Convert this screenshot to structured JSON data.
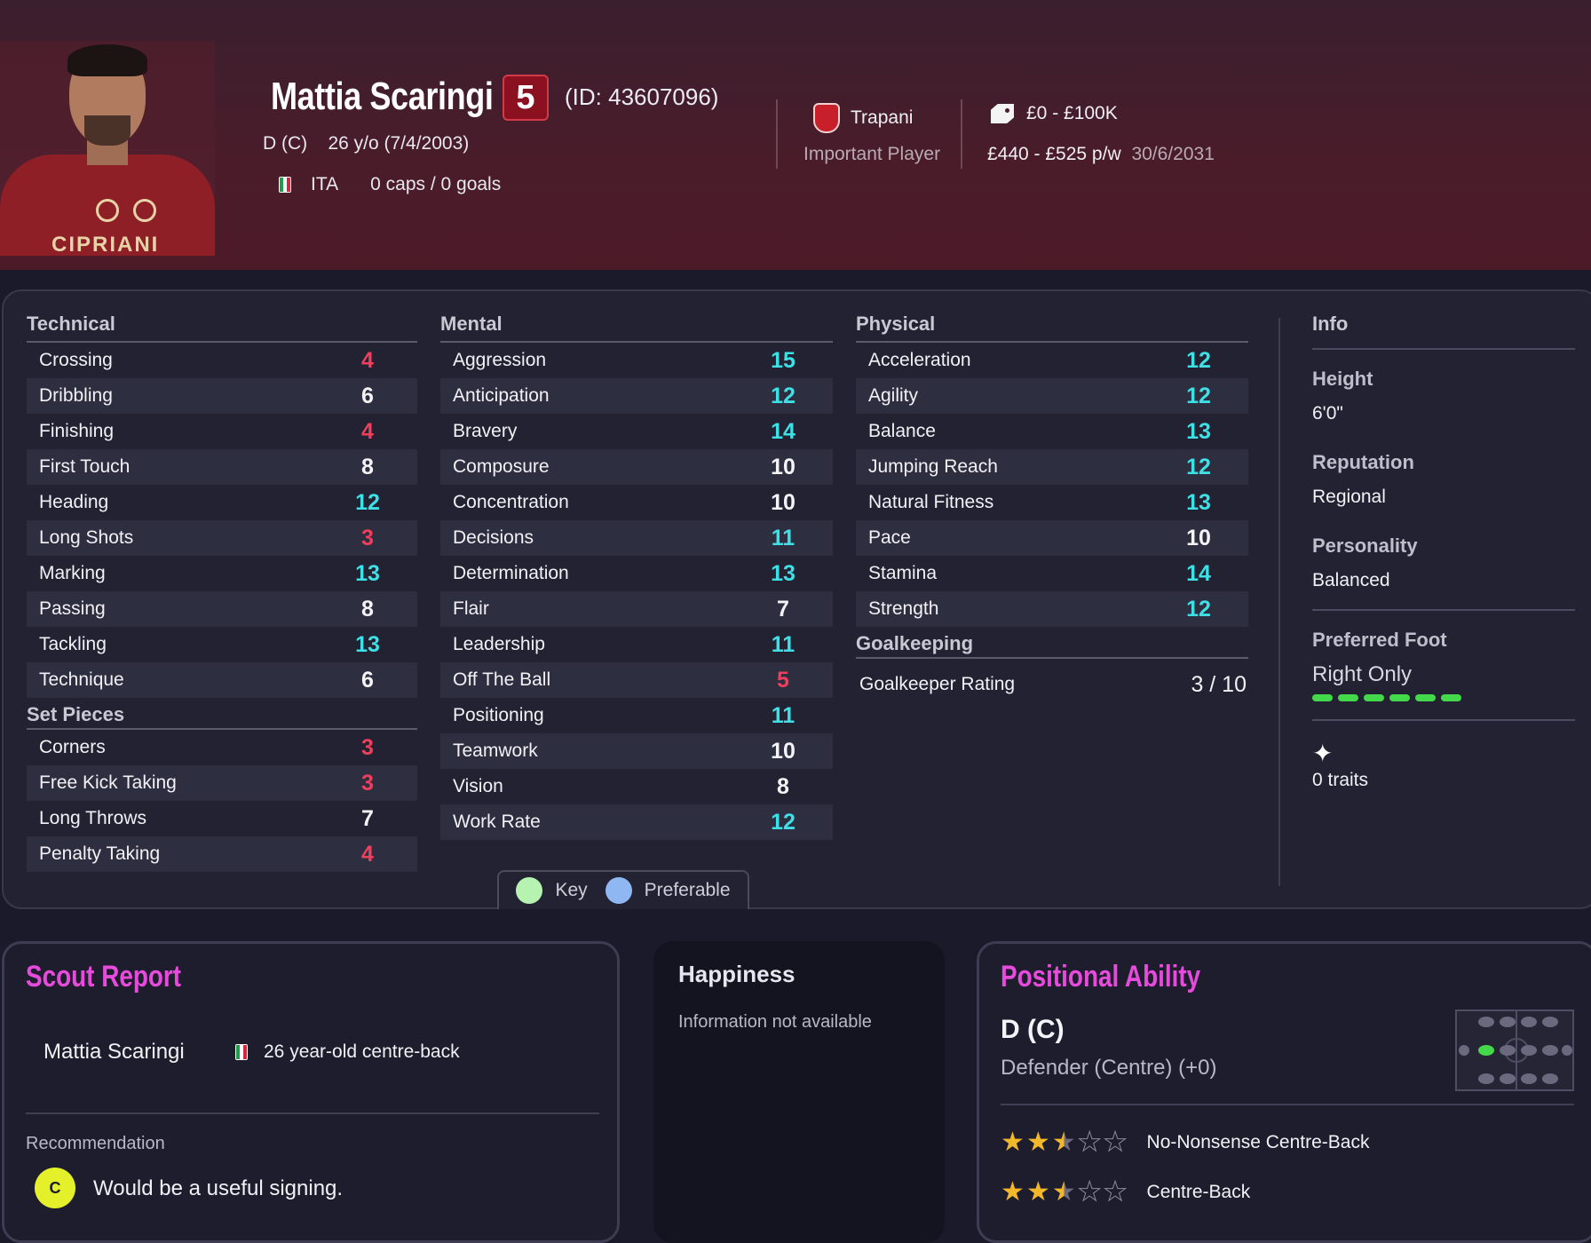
{
  "header": {
    "player_name": "Mattia Scaringi",
    "ability": "5",
    "player_id": "(ID: 43607096)",
    "position_age": "D (C)    26 y/o (7/4/2003)",
    "nation": "ITA",
    "caps_goals": "0 caps / 0 goals",
    "club": "Trapani",
    "squad_status": "Important Player",
    "value": "£0 - £100K",
    "wage": "£440 - £525 p/w",
    "contract_end": "30/6/2031",
    "shirt_sponsor": "CIPRIANI",
    "colors": {
      "background": "#4a1c2a",
      "ability_badge": "#8b1020"
    }
  },
  "technical": {
    "title": "Technical",
    "rows": [
      {
        "name": "Crossing",
        "value": "4",
        "tier": "low"
      },
      {
        "name": "Dribbling",
        "value": "6",
        "tier": "mid"
      },
      {
        "name": "Finishing",
        "value": "4",
        "tier": "low"
      },
      {
        "name": "First Touch",
        "value": "8",
        "tier": "mid"
      },
      {
        "name": "Heading",
        "value": "12",
        "tier": "high"
      },
      {
        "name": "Long Shots",
        "value": "3",
        "tier": "low"
      },
      {
        "name": "Marking",
        "value": "13",
        "tier": "high"
      },
      {
        "name": "Passing",
        "value": "8",
        "tier": "mid"
      },
      {
        "name": "Tackling",
        "value": "13",
        "tier": "high"
      },
      {
        "name": "Technique",
        "value": "6",
        "tier": "mid"
      }
    ]
  },
  "set_pieces": {
    "title": "Set Pieces",
    "rows": [
      {
        "name": "Corners",
        "value": "3",
        "tier": "low"
      },
      {
        "name": "Free Kick Taking",
        "value": "3",
        "tier": "low"
      },
      {
        "name": "Long Throws",
        "value": "7",
        "tier": "mid"
      },
      {
        "name": "Penalty Taking",
        "value": "4",
        "tier": "low"
      }
    ]
  },
  "mental": {
    "title": "Mental",
    "rows": [
      {
        "name": "Aggression",
        "value": "15",
        "tier": "high"
      },
      {
        "name": "Anticipation",
        "value": "12",
        "tier": "high"
      },
      {
        "name": "Bravery",
        "value": "14",
        "tier": "high"
      },
      {
        "name": "Composure",
        "value": "10",
        "tier": "mid"
      },
      {
        "name": "Concentration",
        "value": "10",
        "tier": "mid"
      },
      {
        "name": "Decisions",
        "value": "11",
        "tier": "high"
      },
      {
        "name": "Determination",
        "value": "13",
        "tier": "high"
      },
      {
        "name": "Flair",
        "value": "7",
        "tier": "mid"
      },
      {
        "name": "Leadership",
        "value": "11",
        "tier": "high"
      },
      {
        "name": "Off The Ball",
        "value": "5",
        "tier": "low"
      },
      {
        "name": "Positioning",
        "value": "11",
        "tier": "high"
      },
      {
        "name": "Teamwork",
        "value": "10",
        "tier": "mid"
      },
      {
        "name": "Vision",
        "value": "8",
        "tier": "mid"
      },
      {
        "name": "Work Rate",
        "value": "12",
        "tier": "high"
      }
    ]
  },
  "physical": {
    "title": "Physical",
    "rows": [
      {
        "name": "Acceleration",
        "value": "12",
        "tier": "high"
      },
      {
        "name": "Agility",
        "value": "12",
        "tier": "high"
      },
      {
        "name": "Balance",
        "value": "13",
        "tier": "high"
      },
      {
        "name": "Jumping Reach",
        "value": "12",
        "tier": "high"
      },
      {
        "name": "Natural Fitness",
        "value": "13",
        "tier": "high"
      },
      {
        "name": "Pace",
        "value": "10",
        "tier": "mid"
      },
      {
        "name": "Stamina",
        "value": "14",
        "tier": "high"
      },
      {
        "name": "Strength",
        "value": "12",
        "tier": "high"
      }
    ]
  },
  "goalkeeping": {
    "title": "Goalkeeping",
    "rating_label": "Goalkeeper Rating",
    "rating_value": "3 / 10"
  },
  "info": {
    "title": "Info",
    "height_label": "Height",
    "height_value": "6'0\"",
    "reputation_label": "Reputation",
    "reputation_value": "Regional",
    "personality_label": "Personality",
    "personality_value": "Balanced",
    "foot_label": "Preferred Foot",
    "foot_value": "Right Only",
    "traits": "0 traits"
  },
  "legend": {
    "key_label": "Key",
    "preferable_label": "Preferable",
    "key_color": "#b6f2b0",
    "preferable_color": "#8fb8f2"
  },
  "scout_report": {
    "title": "Scout Report",
    "player_name": "Mattia Scaringi",
    "description": "26 year-old centre-back",
    "recommendation_label": "Recommendation",
    "grade": "C",
    "recommendation": "Would be a useful signing."
  },
  "happiness": {
    "title": "Happiness",
    "text": "Information not available"
  },
  "positional_ability": {
    "title": "Positional Ability",
    "position": "D (C)",
    "description": "Defender (Centre) (+0)",
    "roles": [
      {
        "name": "No-Nonsense Centre-Back",
        "stars": 2.5
      },
      {
        "name": "Centre-Back",
        "stars": 2.5
      }
    ]
  }
}
